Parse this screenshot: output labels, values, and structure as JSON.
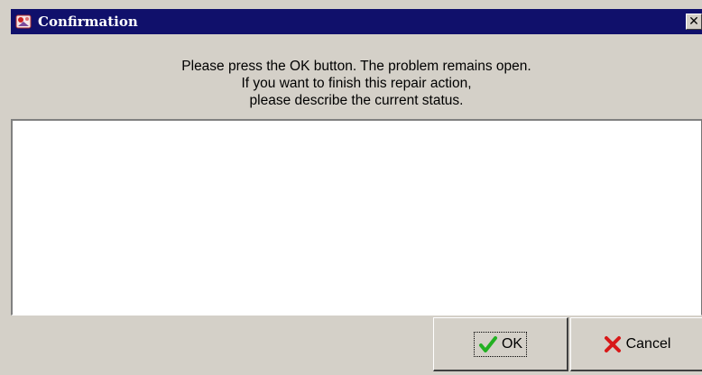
{
  "window": {
    "title": "Confirmation",
    "close_glyph": "✕"
  },
  "message": {
    "lines": [
      "Please press the OK button. The problem remains open.",
      "If you want to finish this repair action,",
      "please describe the current status."
    ]
  },
  "status_input": {
    "value": ""
  },
  "buttons": {
    "ok_label": "OK",
    "ok_icon": "checkmark-icon",
    "cancel_label": "Cancel",
    "cancel_icon": "x-mark-icon"
  },
  "colors": {
    "titlebar": "#10106b",
    "dialog_bg": "#d4d0c8",
    "ok_icon": "#22b022",
    "cancel_icon": "#d81818"
  }
}
